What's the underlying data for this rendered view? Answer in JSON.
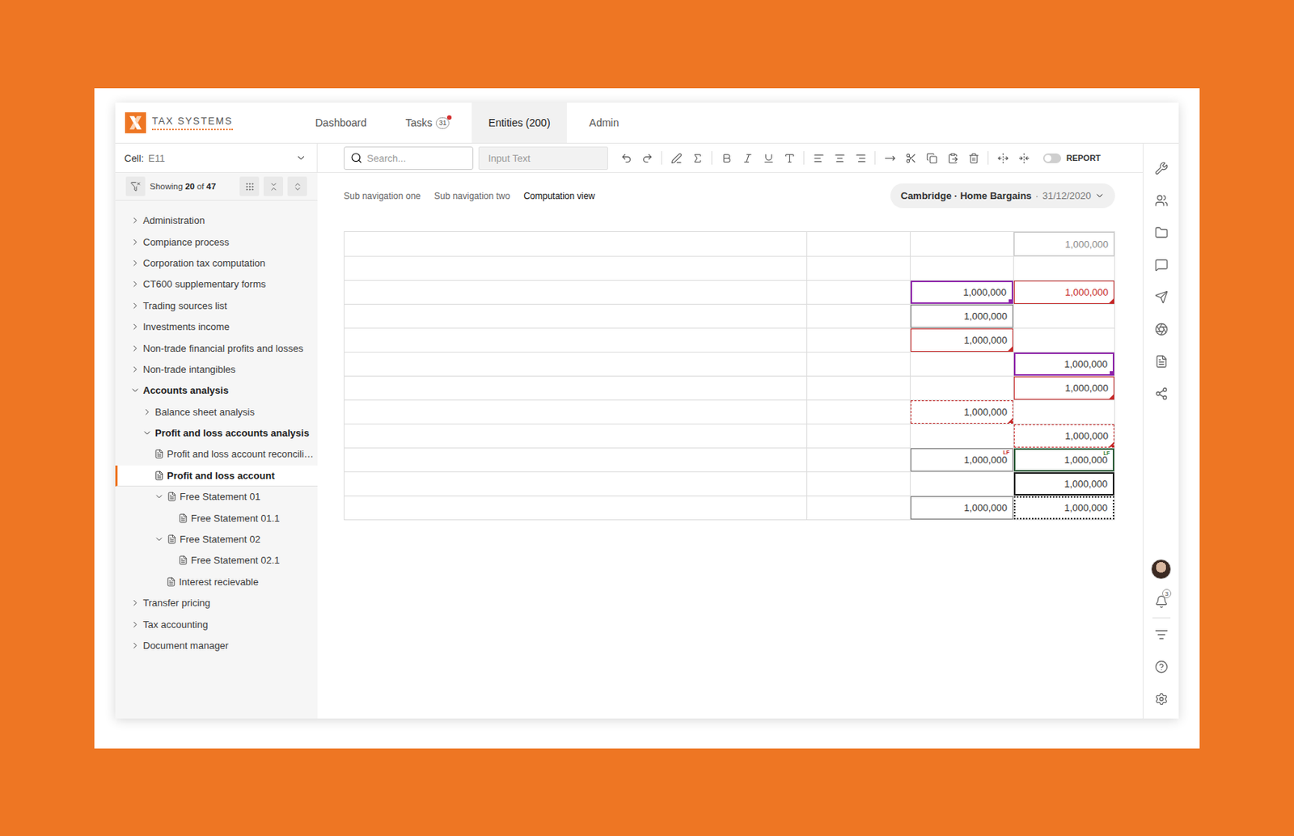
{
  "app": {
    "brand": "TAX SYSTEMS"
  },
  "nav": [
    {
      "label": "Dashboard",
      "selected": false
    },
    {
      "label": "Tasks",
      "badge": "31",
      "alert": true,
      "selected": false
    },
    {
      "label": "Entities (200)",
      "selected": true
    },
    {
      "label": "Admin",
      "selected": false
    }
  ],
  "toolbar": {
    "cellLabel": "Cell:",
    "cellRef": "E11",
    "searchPlaceholder": "Search...",
    "inputPlaceholder": "Input Text",
    "report": {
      "label": "REPORT",
      "on": false
    }
  },
  "sidebar": {
    "filter": {
      "prefix": "Showing",
      "shown": "20",
      "of": "of",
      "total": "47"
    },
    "items": [
      {
        "label": "Administration",
        "level": 0,
        "kind": "folder",
        "expanded": false,
        "bold": false,
        "selected": false
      },
      {
        "label": "Compiance process",
        "level": 0,
        "kind": "folder",
        "expanded": false,
        "bold": false,
        "selected": false
      },
      {
        "label": "Corporation tax computation",
        "level": 0,
        "kind": "folder",
        "expanded": false,
        "bold": false,
        "selected": false
      },
      {
        "label": "CT600 supplementary forms",
        "level": 0,
        "kind": "folder",
        "expanded": false,
        "bold": false,
        "selected": false
      },
      {
        "label": "Trading sources list",
        "level": 0,
        "kind": "folder",
        "expanded": false,
        "bold": false,
        "selected": false
      },
      {
        "label": "Investments income",
        "level": 0,
        "kind": "folder",
        "expanded": false,
        "bold": false,
        "selected": false
      },
      {
        "label": "Non-trade financial profits and losses",
        "level": 0,
        "kind": "folder",
        "expanded": false,
        "bold": false,
        "selected": false
      },
      {
        "label": "Non-trade intangibles",
        "level": 0,
        "kind": "folder",
        "expanded": false,
        "bold": false,
        "selected": false
      },
      {
        "label": "Accounts analysis",
        "level": 0,
        "kind": "folder",
        "expanded": true,
        "bold": true,
        "selected": false
      },
      {
        "label": "Balance sheet analysis",
        "level": 1,
        "kind": "folder",
        "expanded": false,
        "bold": false,
        "selected": false
      },
      {
        "label": "Profit and loss accounts analysis",
        "level": 1,
        "kind": "folder",
        "expanded": true,
        "bold": true,
        "selected": false
      },
      {
        "label": "Profit and loss account reconcili…",
        "level": 2,
        "kind": "doc",
        "expanded": false,
        "bold": false,
        "selected": false
      },
      {
        "label": "Profit and loss account",
        "level": 2,
        "kind": "doc",
        "expanded": false,
        "bold": true,
        "selected": true
      },
      {
        "label": "Free Statement 01",
        "level": 2,
        "kind": "doc-parent",
        "expanded": true,
        "bold": false,
        "selected": false
      },
      {
        "label": "Free Statement 01.1",
        "level": 4,
        "kind": "doc",
        "expanded": false,
        "bold": false,
        "selected": false
      },
      {
        "label": "Free Statement 02",
        "level": 2,
        "kind": "doc-parent",
        "expanded": true,
        "bold": false,
        "selected": false
      },
      {
        "label": "Free Statement 02.1",
        "level": 4,
        "kind": "doc",
        "expanded": false,
        "bold": false,
        "selected": false
      },
      {
        "label": "Interest recievable",
        "level": 3,
        "kind": "doc",
        "expanded": false,
        "bold": false,
        "selected": false
      },
      {
        "label": "Transfer pricing",
        "level": 0,
        "kind": "folder",
        "expanded": false,
        "bold": false,
        "selected": false
      },
      {
        "label": "Tax accounting",
        "level": 0,
        "kind": "folder",
        "expanded": false,
        "bold": false,
        "selected": false
      },
      {
        "label": "Document manager",
        "level": 0,
        "kind": "folder",
        "expanded": false,
        "bold": false,
        "selected": false
      }
    ]
  },
  "subnav": [
    {
      "label": "Sub navigation one",
      "selected": false
    },
    {
      "label": "Sub navigation two",
      "selected": false
    },
    {
      "label": "Computation view",
      "selected": true
    }
  ],
  "context": {
    "entity": "Cambridge · Home Bargains",
    "separator": "·",
    "date": "31/12/2020"
  },
  "table": {
    "rows": [
      {
        "cells": [
          null,
          null,
          null,
          {
            "value": "1,000,000",
            "kind": "readonly"
          }
        ]
      },
      {
        "cells": [
          null,
          null,
          null,
          null
        ]
      },
      {
        "cells": [
          null,
          null,
          {
            "value": "1,000,000",
            "kind": "purple"
          },
          {
            "value": "1,000,000",
            "kind": "error-text"
          }
        ]
      },
      {
        "cells": [
          null,
          null,
          {
            "value": "1,000,000",
            "kind": "boxed"
          },
          null
        ]
      },
      {
        "cells": [
          null,
          null,
          {
            "value": "1,000,000",
            "kind": "error"
          },
          null
        ]
      },
      {
        "cells": [
          null,
          null,
          null,
          {
            "value": "1,000,000",
            "kind": "purple"
          }
        ]
      },
      {
        "cells": [
          null,
          null,
          null,
          {
            "value": "1,000,000",
            "kind": "error"
          }
        ]
      },
      {
        "cells": [
          null,
          null,
          {
            "value": "1,000,000",
            "kind": "dashed-error"
          },
          null
        ]
      },
      {
        "cells": [
          null,
          null,
          null,
          {
            "value": "1,000,000",
            "kind": "dashed-error"
          }
        ]
      },
      {
        "cells": [
          null,
          null,
          {
            "value": "1,000,000",
            "kind": "boxed",
            "marker": {
              "text": "LF",
              "color": "#c62828"
            }
          },
          {
            "value": "1,000,000",
            "kind": "linked",
            "marker": {
              "text": "LF",
              "color": "#2e7d32"
            }
          }
        ]
      },
      {
        "cells": [
          null,
          null,
          null,
          {
            "value": "1,000,000",
            "kind": "selected"
          }
        ]
      },
      {
        "cells": [
          null,
          null,
          {
            "value": "1,000,000",
            "kind": "boxed"
          },
          {
            "value": "1,000,000",
            "kind": "dotted"
          }
        ]
      }
    ]
  },
  "rail": {
    "notifications": "3"
  }
}
